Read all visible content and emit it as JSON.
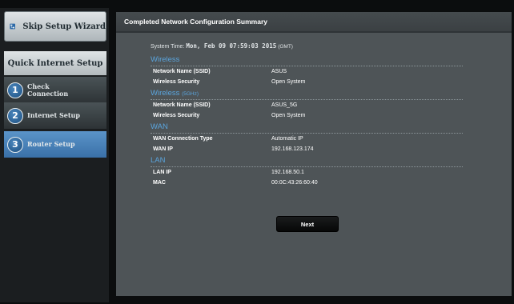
{
  "sidebar": {
    "skip_wizard_label": "Skip Setup Wizard",
    "skip_wizard_icon": "network-icon",
    "section_title": "Quick Internet Setup",
    "steps": [
      {
        "number": "1",
        "line1": "Check",
        "line2": "Connection",
        "active": false
      },
      {
        "number": "2",
        "line1": "Internet Setup",
        "line2": "",
        "active": false
      },
      {
        "number": "3",
        "line1": "Router Setup",
        "line2": "",
        "active": true
      }
    ]
  },
  "main": {
    "title": "Completed Network Configuration Summary",
    "system_time_label": "System Time:",
    "system_time_value": "Mon, Feb 09 07:59:03 2015",
    "system_time_zone": "(GMT)",
    "sections": {
      "wireless": {
        "title": "Wireless",
        "rows": [
          {
            "label": "Network Name (SSID)",
            "value": "ASUS"
          },
          {
            "label": "Wireless Security",
            "value": "Open System"
          }
        ]
      },
      "wireless5": {
        "title": "Wireless",
        "title_suffix": "(5GHz)",
        "rows": [
          {
            "label": "Network Name (SSID)",
            "value": "ASUS_5G"
          },
          {
            "label": "Wireless Security",
            "value": "Open System"
          }
        ]
      },
      "wan": {
        "title": "WAN",
        "rows": [
          {
            "label": "WAN Connection Type",
            "value": "Automatic IP"
          },
          {
            "label": "WAN IP",
            "value": "192.168.123.174"
          }
        ]
      },
      "lan": {
        "title": "LAN",
        "rows": [
          {
            "label": "LAN IP",
            "value": "192.168.50.1"
          },
          {
            "label": "MAC",
            "value": "00:0C:43:26:60:40"
          }
        ]
      }
    },
    "next_label": "Next"
  },
  "colors": {
    "accent_blue": "#5aa4dc",
    "active_step": "#4a82b9",
    "panel_bg": "#4e5457"
  }
}
